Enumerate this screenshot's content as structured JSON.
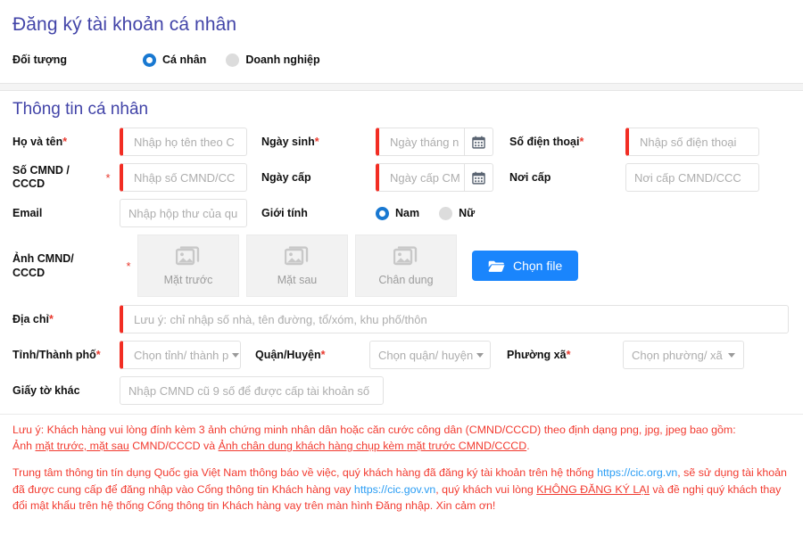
{
  "header": {
    "title": "Đăng ký tài khoản cá nhân",
    "subject_label": "Đối tượng",
    "options": [
      {
        "label": "Cá nhân",
        "selected": true
      },
      {
        "label": "Doanh nghiệp",
        "selected": false
      }
    ]
  },
  "section": {
    "title": "Thông tin cá nhân"
  },
  "fields": {
    "full_name": {
      "label": "Họ và tên",
      "required": true,
      "placeholder": "Nhập họ tên theo C"
    },
    "birth_date": {
      "label": "Ngày sinh",
      "required": true,
      "placeholder": "Ngày tháng n",
      "icon": "calendar-icon"
    },
    "phone": {
      "label": "Số điện thoại",
      "required": true,
      "placeholder": "Nhập số điện thoại"
    },
    "id_number": {
      "label_line1": "Số CMND /",
      "label_line2": "CCCD",
      "required_mark": "*",
      "placeholder": "Nhập số CMND/CC"
    },
    "issue_date": {
      "label": "Ngày cấp",
      "required": false,
      "placeholder": "Ngày cấp CM",
      "icon": "calendar-icon"
    },
    "issue_place": {
      "label": "Nơi cấp",
      "required": false,
      "placeholder": "Nơi cấp CMND/CCC"
    },
    "email": {
      "label": "Email",
      "required": false,
      "placeholder": "Nhập hộp thư của qu"
    },
    "gender": {
      "label": "Giới tính",
      "options": [
        {
          "label": "Nam",
          "selected": true
        },
        {
          "label": "Nữ",
          "selected": false
        }
      ]
    },
    "id_photos": {
      "label_line1": "Ảnh CMND/",
      "label_line2": "CCCD",
      "required_mark": "*"
    },
    "address": {
      "label": "Địa chỉ",
      "required": true,
      "placeholder": "Lưu ý: chỉ nhập số nhà, tên đường, tổ/xóm, khu phố/thôn"
    },
    "province": {
      "label": "Tỉnh/Thành phố",
      "required": true,
      "placeholder": "Chọn tỉnh/ thành p"
    },
    "district": {
      "label": "Quận/Huyện",
      "required": true,
      "placeholder": "Chọn quận/ huyện"
    },
    "ward": {
      "label": "Phường xã",
      "required": true,
      "placeholder": "Chọn phường/ xã"
    },
    "other_docs": {
      "label": "Giấy tờ khác",
      "required": false,
      "placeholder": "Nhập CMND cũ 9 số để được cấp tài khoản số"
    }
  },
  "upload": {
    "thumbs": [
      {
        "caption": "Mặt trước",
        "icon": "image-icon"
      },
      {
        "caption": "Mặt sau",
        "icon": "image-icon"
      },
      {
        "caption": "Chân dung",
        "icon": "image-icon"
      }
    ],
    "button_label": "Chọn file",
    "button_icon": "folder-icon"
  },
  "notices": {
    "note1_a": "Lưu ý: Khách hàng vui lòng đính kèm 3 ảnh chứng minh nhân dân hoặc căn cước công dân (CMND/CCCD) theo định dạng png, jpg, jpeg bao gồm:",
    "note1_b_pre": "Ảnh ",
    "note1_b_u1": "mặt trước, mặt sau",
    "note1_b_mid": " CMND/CCCD và ",
    "note1_b_u2": "Ảnh chân dung khách hàng chụp kèm mặt trước CMND/CCCD",
    "note1_b_end": ".",
    "note2_p1": "Trung tâm thông tin tín dụng Quốc gia Việt Nam thông báo về việc, quý khách hàng đã đăng ký tài khoản trên hệ thống ",
    "note2_link1": "https://cic.org.vn",
    "note2_p2": ", sẽ sử dụng tài khoản đã được cung cấp để đăng nhập vào Cổng thông tin Khách hàng vay ",
    "note2_link2": "https://cic.gov.vn",
    "note2_p3": ", quý khách vui lòng ",
    "note2_emph": "KHÔNG ĐĂNG KÝ LẠI",
    "note2_p4": " và đề nghị quý khách thay đổi mật khẩu trên hệ thống Cổng thông tin Khách hàng vay trên màn hình Đăng nhập. Xin cảm ơn!"
  },
  "colors": {
    "title": "#4244a8",
    "required": "#f22d23",
    "notice": "#f23b30",
    "link": "#2a9df4",
    "primary_button": "#1a85fc",
    "radio_on": "#1878d1"
  }
}
